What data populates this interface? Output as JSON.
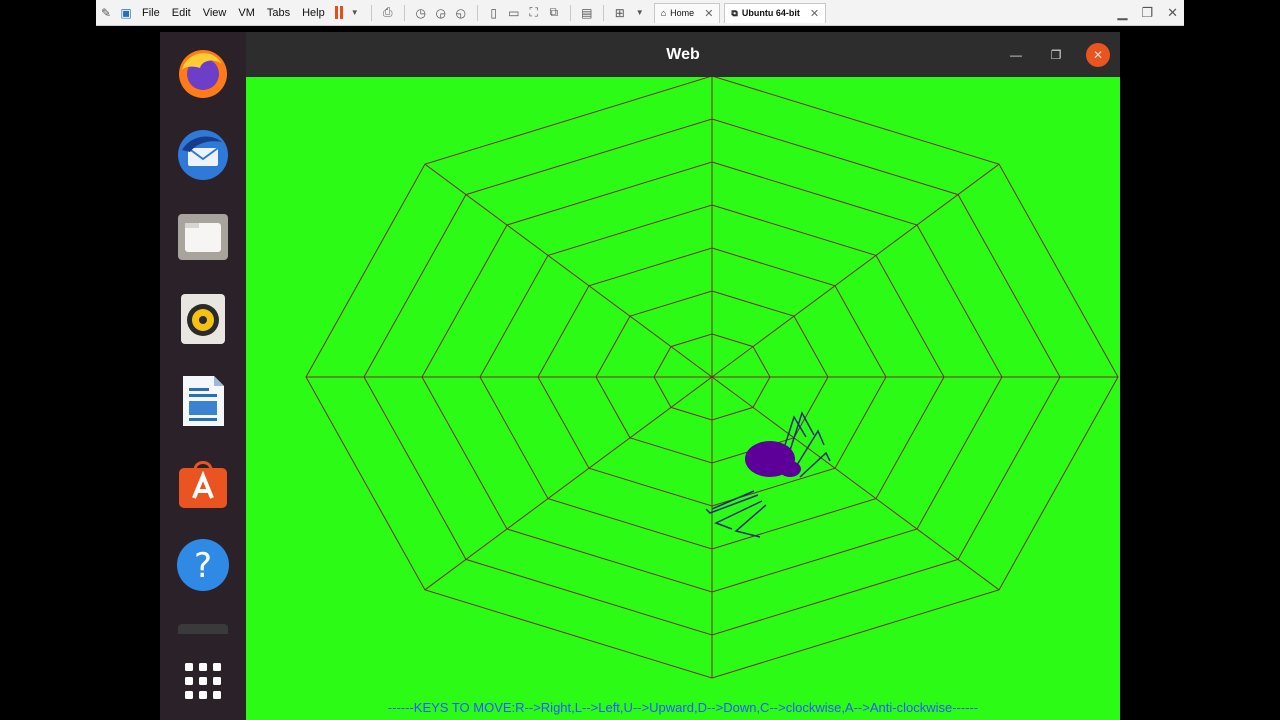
{
  "vmware": {
    "menu": [
      "File",
      "Edit",
      "View",
      "VM",
      "Tabs",
      "Help"
    ],
    "tabs": [
      {
        "label": "Home",
        "active": false
      },
      {
        "label": "Ubuntu 64-bit",
        "active": true
      }
    ],
    "pause_color": "#e0501b"
  },
  "dock": {
    "apps": [
      "firefox-icon",
      "thunderbird-icon",
      "files-icon",
      "rhythmbox-icon",
      "libreoffice-writer-icon",
      "ubuntu-software-icon",
      "help-icon",
      "trash-icon"
    ],
    "show_apps": "show-applications-icon",
    "background": "#2b2129"
  },
  "window": {
    "title": "Web",
    "close_color": "#e95420",
    "canvas_color": "#2cfc15",
    "web_color": "#7a2c2c",
    "spider_color": "#5c0099",
    "instructions": "------KEYS TO MOVE:R-->Right,L-->Left,U-->Upward,D-->Down,C-->clockwise,A-->Anti-clockwise------"
  }
}
